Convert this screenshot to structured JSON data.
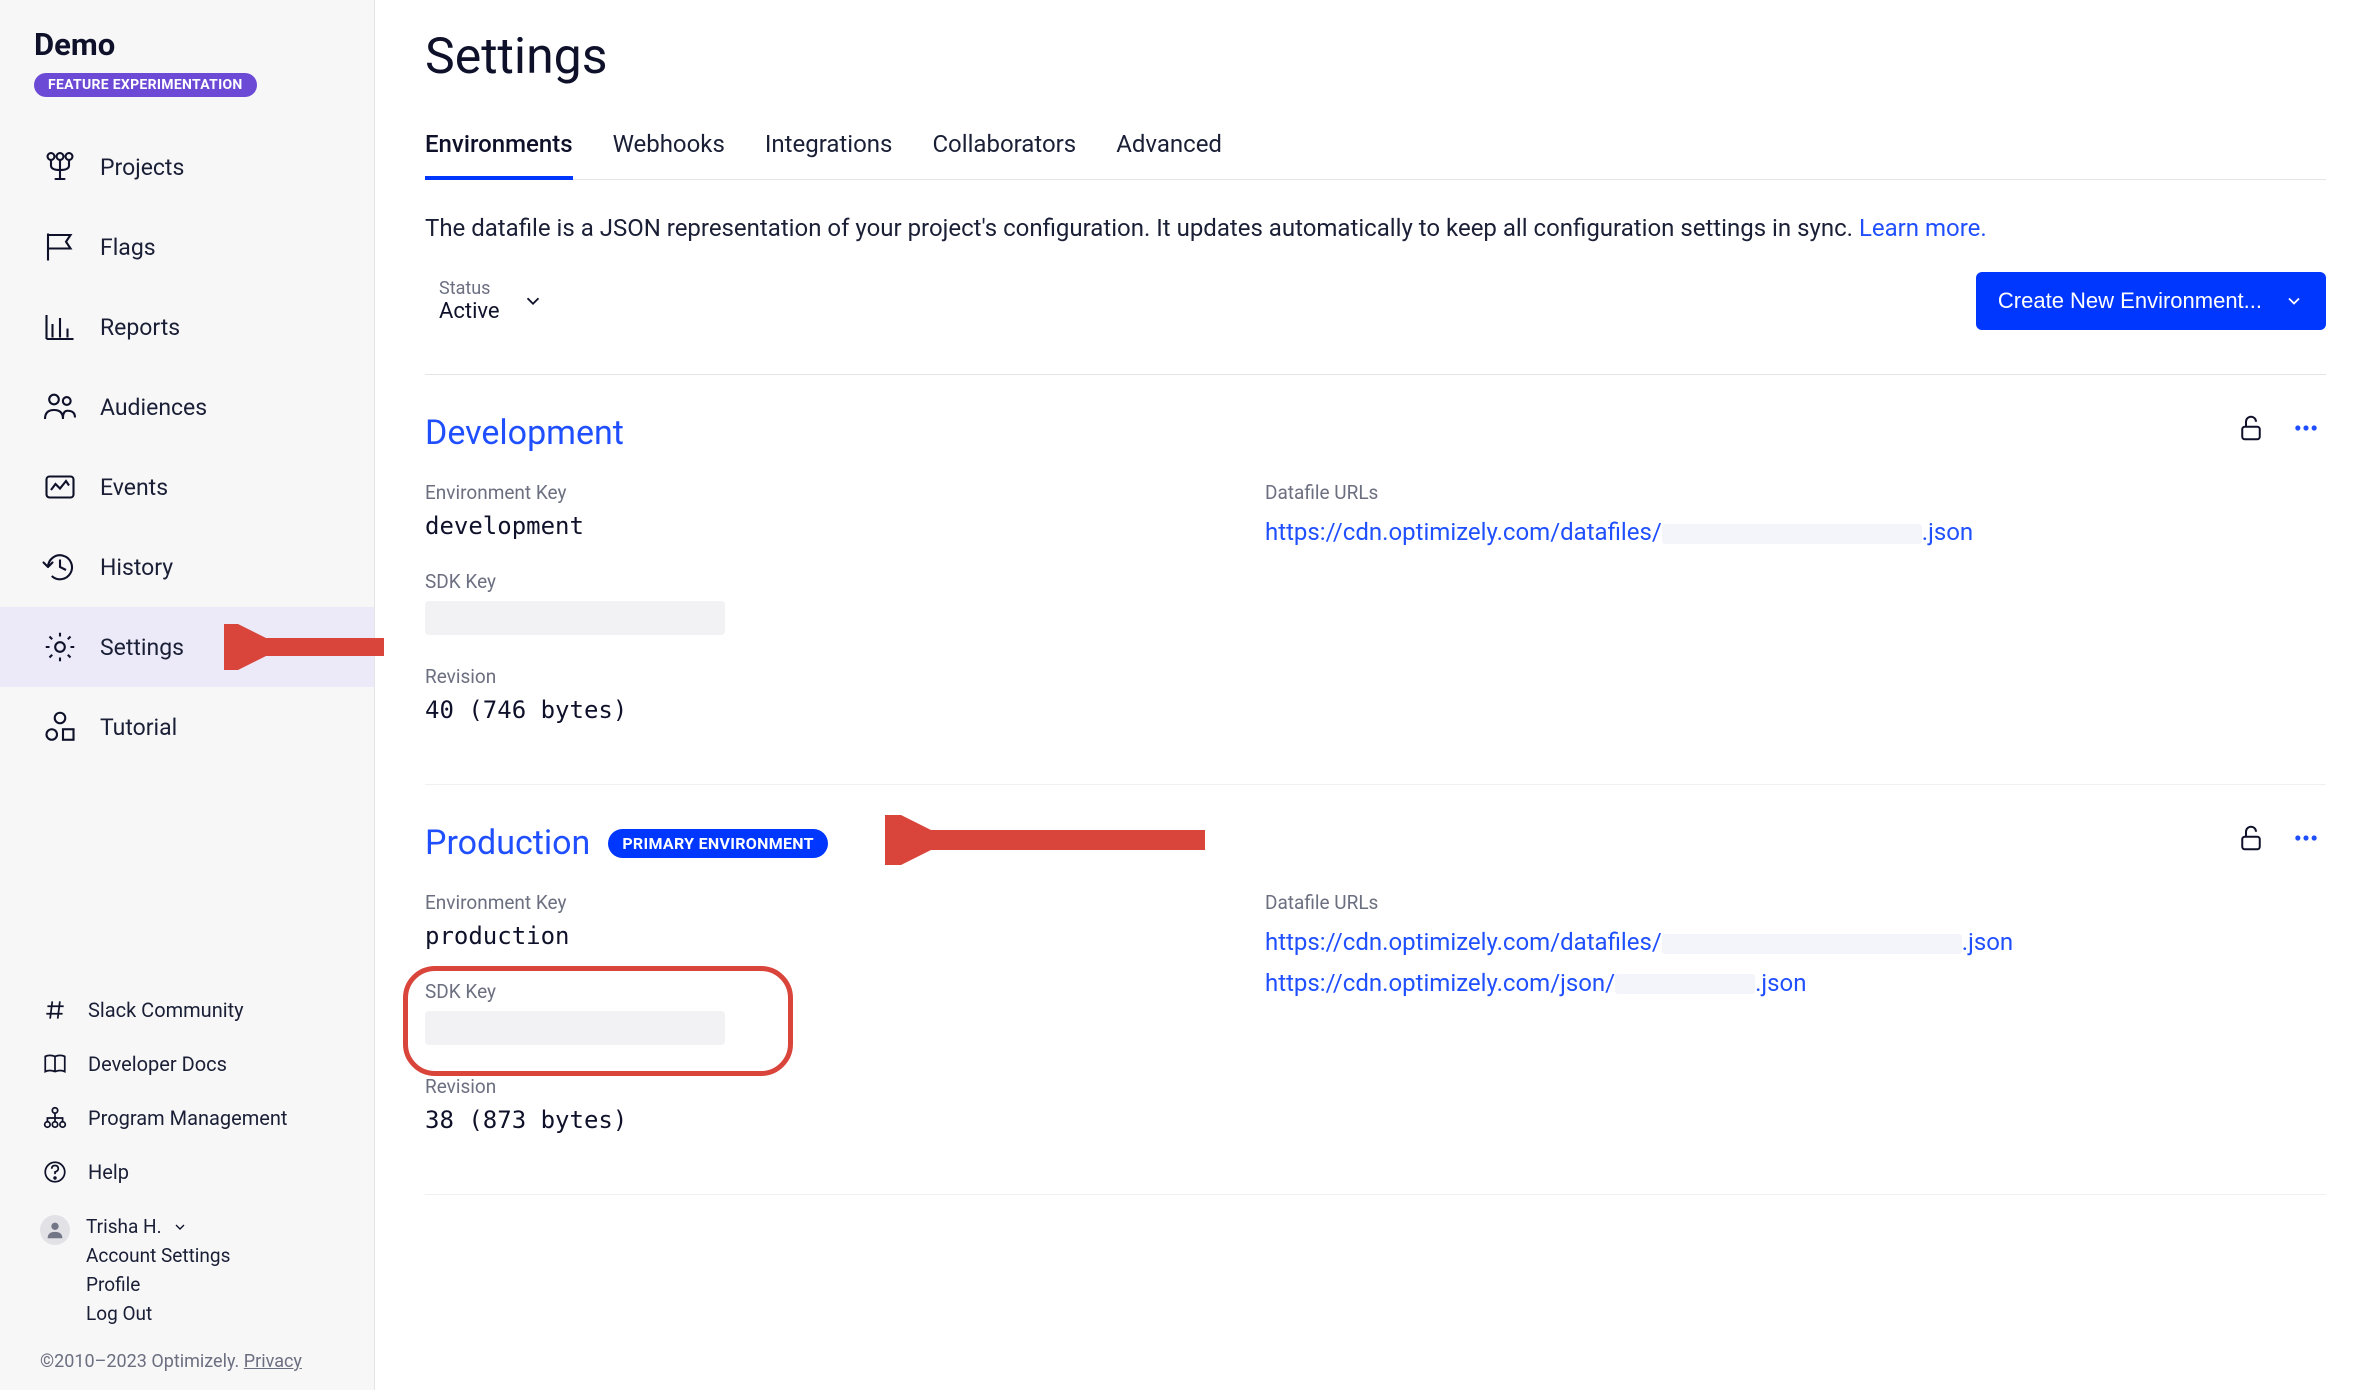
{
  "brand": {
    "title": "Demo",
    "badge": "FEATURE EXPERIMENTATION"
  },
  "nav": {
    "projects": "Projects",
    "flags": "Flags",
    "reports": "Reports",
    "audiences": "Audiences",
    "events": "Events",
    "history": "History",
    "settings": "Settings",
    "tutorial": "Tutorial"
  },
  "footer_links": {
    "slack": "Slack Community",
    "docs": "Developer Docs",
    "program": "Program Management",
    "help": "Help"
  },
  "user": {
    "name": "Trisha H.",
    "account_settings": "Account Settings",
    "profile": "Profile",
    "logout": "Log Out"
  },
  "copyright": {
    "text": "©2010–2023 Optimizely.",
    "privacy": "Privacy"
  },
  "page": {
    "title": "Settings",
    "tabs": {
      "environments": "Environments",
      "webhooks": "Webhooks",
      "integrations": "Integrations",
      "collaborators": "Collaborators",
      "advanced": "Advanced"
    },
    "intro_pre": "The datafile is a JSON representation of your project's configuration. It updates automatically to keep all configuration settings in sync. ",
    "intro_link": "Learn more.",
    "status": {
      "label": "Status",
      "value": "Active"
    },
    "new_env": "Create New Environment..."
  },
  "labels": {
    "env_key": "Environment Key",
    "datafile_urls": "Datafile URLs",
    "sdk_key": "SDK Key",
    "revision": "Revision"
  },
  "environments": {
    "development": {
      "title": "Development",
      "env_key": "development",
      "revision": "40 (746 bytes)",
      "datafile_url_prefix": "https://cdn.optimizely.com/datafiles/",
      "datafile_url_suffix": ".json"
    },
    "production": {
      "title": "Production",
      "primary_badge": "PRIMARY ENVIRONMENT",
      "env_key": "production",
      "revision": "38 (873 bytes)",
      "datafile_url1_prefix": "https://cdn.optimizely.com/datafiles/",
      "datafile_url1_suffix": ".json",
      "datafile_url2_prefix": "https://cdn.optimizely.com/json/",
      "datafile_url2_suffix": ".json"
    }
  }
}
